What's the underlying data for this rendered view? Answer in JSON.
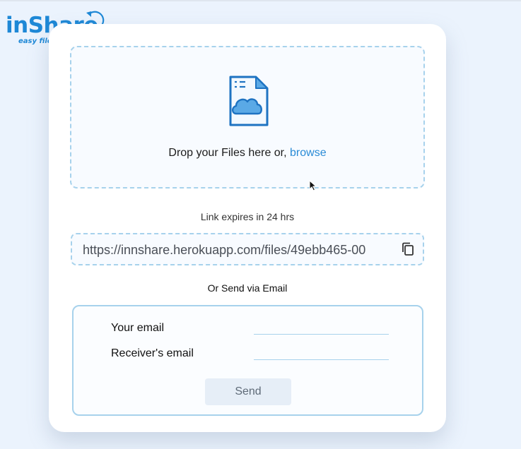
{
  "logo": {
    "name": "inShare",
    "tagline": "easy file sharing"
  },
  "upload": {
    "prompt": "Drop your Files here or, ",
    "browse_label": "browse"
  },
  "share": {
    "expiry_text": "Link expires in 24 hrs",
    "link_value": "https://innshare.herokuapp.com/files/49ebb465-00"
  },
  "email": {
    "heading": "Or Send via Email",
    "sender_label": "Your email",
    "receiver_label": "Receiver's email",
    "send_label": "Send"
  },
  "colors": {
    "accent": "#1e88d6",
    "border": "#a7d2ec",
    "background": "#ebf3fd"
  },
  "icons": [
    "file-cloud-icon",
    "copy-icon",
    "logo-arrow-icon",
    "mouse-cursor-icon"
  ]
}
